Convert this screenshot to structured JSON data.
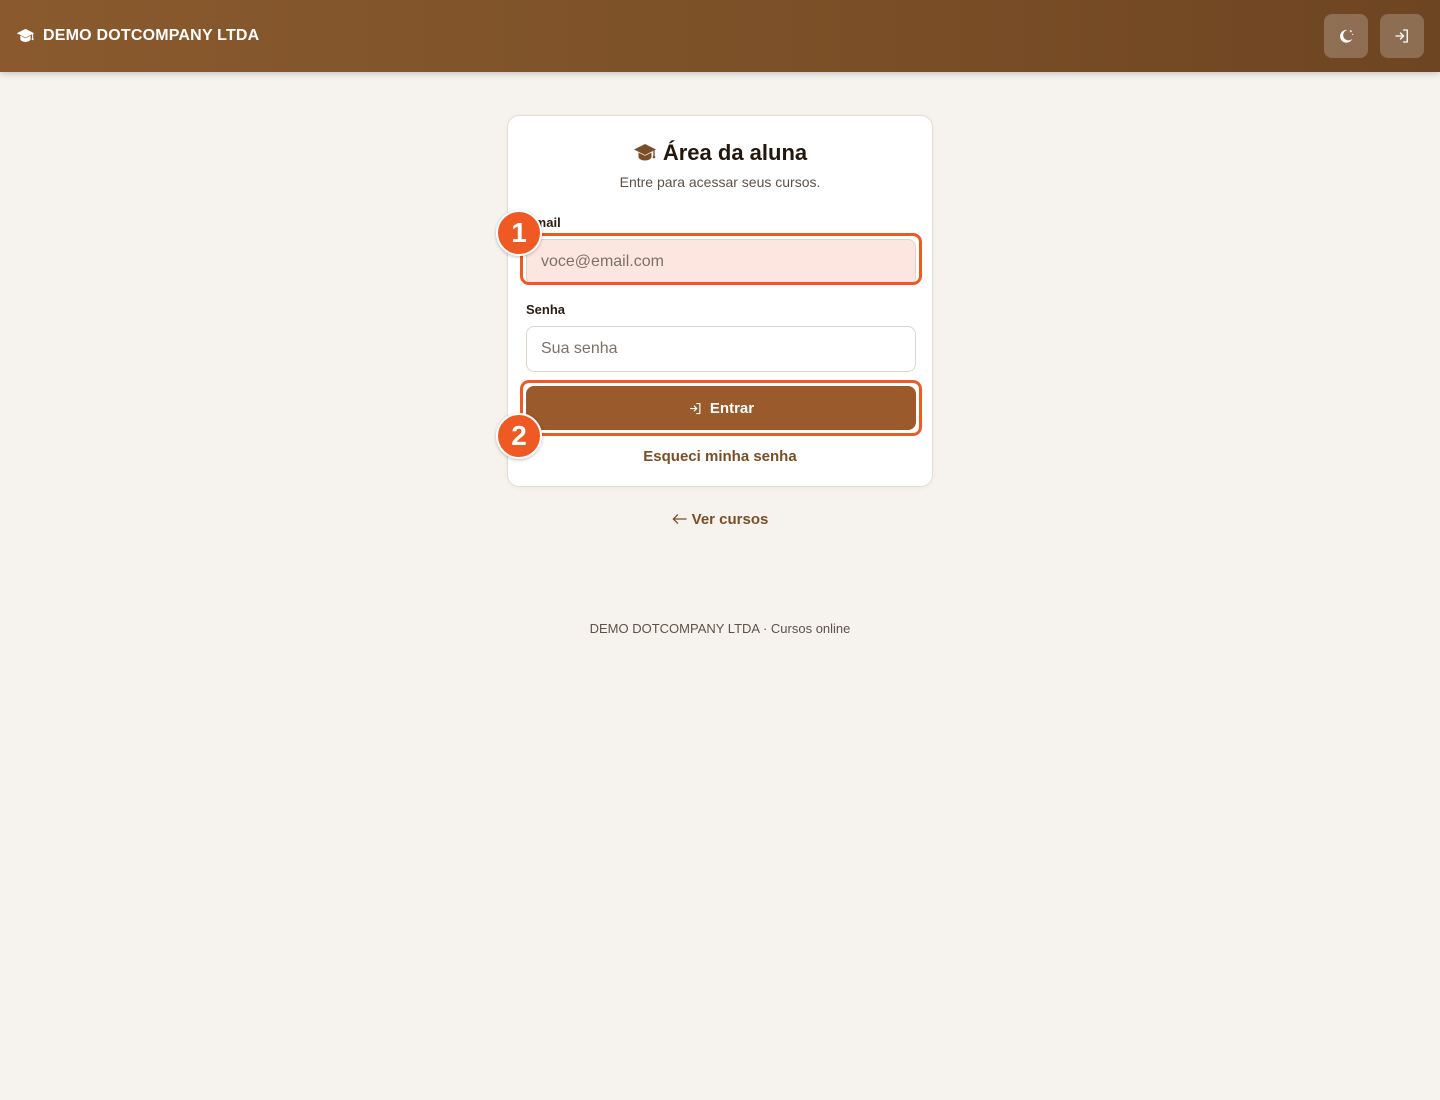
{
  "header": {
    "brand": "DEMO DOTCOMPANY LTDA",
    "brand_icon": "graduation-cap-icon",
    "theme_toggle_icon": "moon-stars-icon",
    "login_icon": "login-icon"
  },
  "login_card": {
    "title": "Área da aluna",
    "title_icon": "graduation-cap-icon",
    "subtitle": "Entre para acessar seus cursos.",
    "email": {
      "label": "Email",
      "placeholder": "voce@email.com",
      "value": ""
    },
    "password": {
      "label": "Senha",
      "placeholder": "Sua senha",
      "value": ""
    },
    "submit_label": "Entrar",
    "forgot_label": "Esqueci minha senha"
  },
  "annotations": {
    "step_1": "1",
    "step_2": "2"
  },
  "back_link": "Ver cursos",
  "footer": "DEMO DOTCOMPANY LTDA · Cursos online",
  "colors": {
    "header": "#7a4f27",
    "accent_button": "#9a5a2c",
    "link": "#7a4f27",
    "highlight": "#ef5a24",
    "page_background": "#f6f3ee"
  }
}
